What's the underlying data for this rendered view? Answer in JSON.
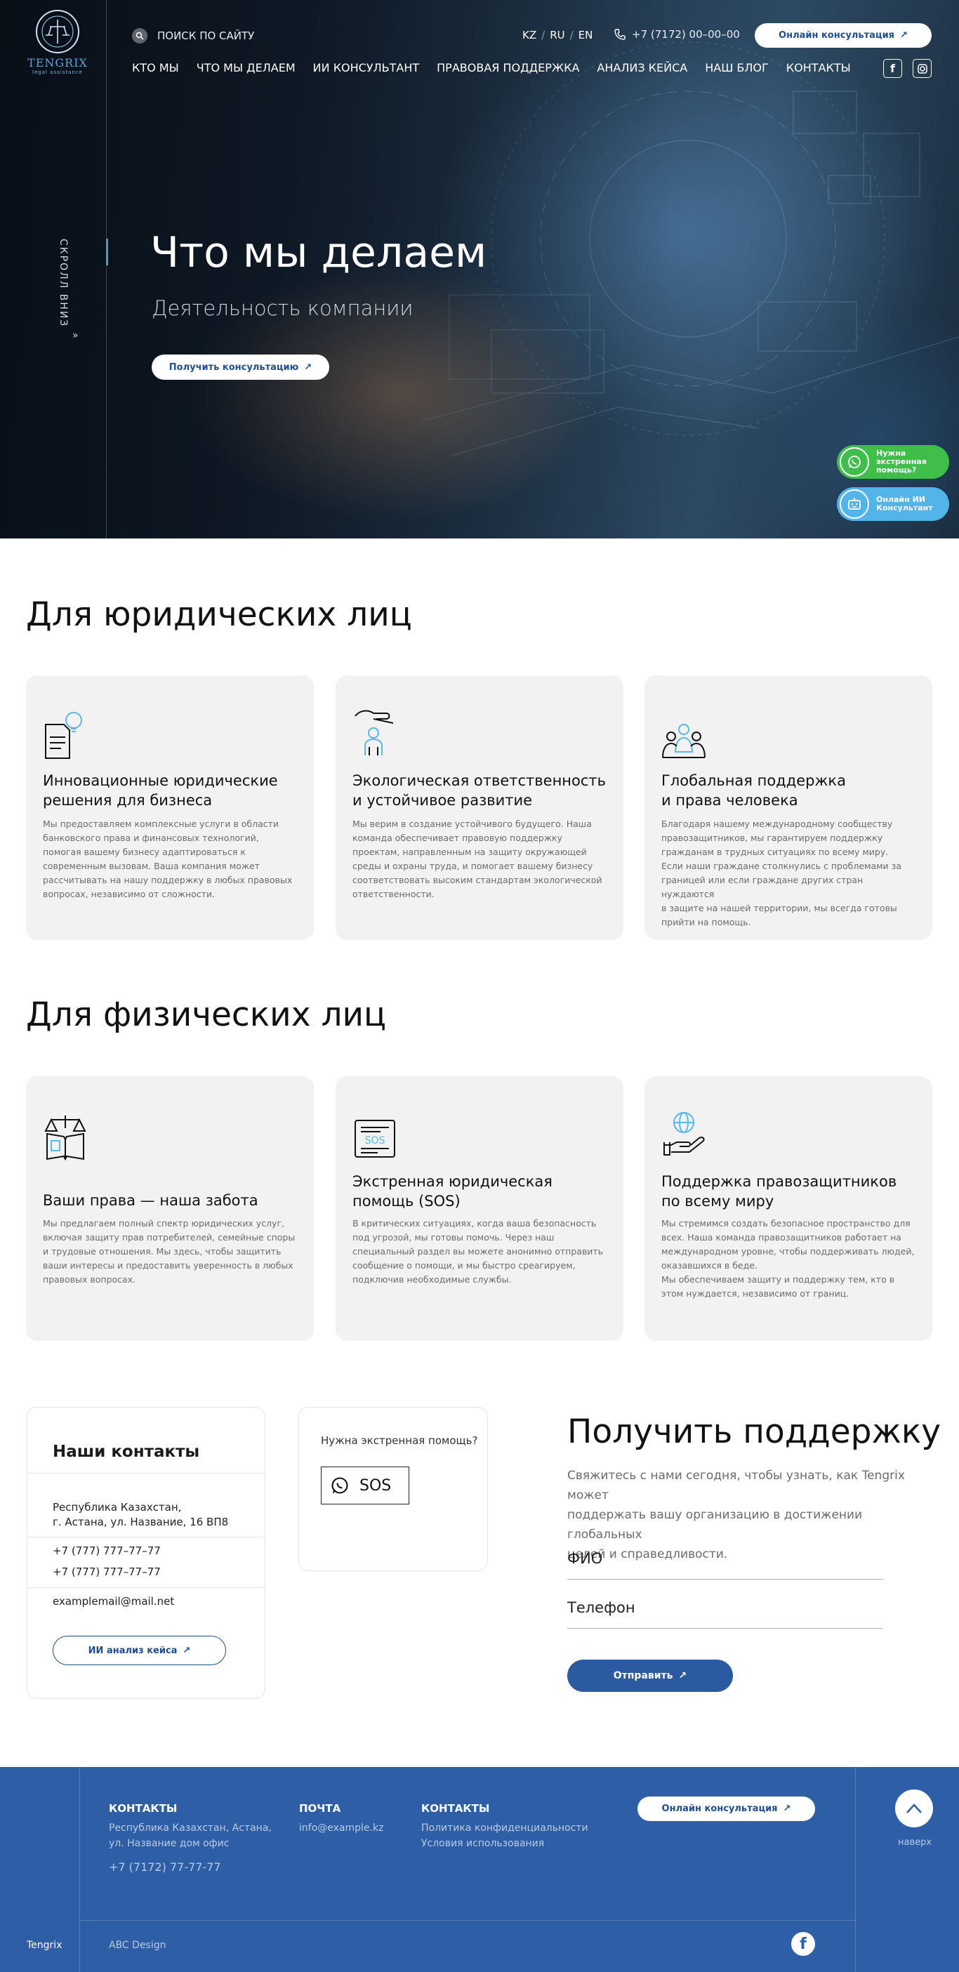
{
  "brand": {
    "name": "TENGRIX",
    "tagline": "legal assistance"
  },
  "header": {
    "search_placeholder": "ПОИСК ПО САЙТУ",
    "languages": [
      "KZ",
      "RU",
      "EN"
    ],
    "phone": "+7 (7172) 00–00–00",
    "cta_label": "Онлайн консультация",
    "nav": [
      "КТО МЫ",
      "ЧТО МЫ ДЕЛАЕМ",
      "ИИ КОНСУЛЬТАНТ",
      "ПРАВОВАЯ ПОДДЕРЖКА",
      "АНАЛИЗ КЕЙСА",
      "НАШ БЛОГ",
      "КОНТАКТЫ"
    ],
    "social": [
      "facebook-icon",
      "instagram-icon"
    ]
  },
  "hero": {
    "scroll_label": "СКРОЛЛ ВНИЗ",
    "title": "Что мы делаем",
    "subtitle": "Деятельность компании",
    "button_label": "Получить консультацию"
  },
  "floating": {
    "emergency": [
      "Нужна",
      "экстренная",
      "помощь?"
    ],
    "ai": [
      "Онлайн ИИ",
      "Консультант"
    ]
  },
  "legal_section": {
    "title": "Для юридических лиц",
    "cards": [
      {
        "icon": "document-idea-icon",
        "title_lines": [
          "Инновационные юридические",
          "решения для бизнеса"
        ],
        "text_lines": [
          "Мы предоставляем комплексные услуги в области",
          "банковского права и финансовых технологий,",
          "помогая вашему бизнесу адаптироваться к",
          "современным вызовам. Ваша компания может",
          "рассчитывать на нашу поддержку в любых правовых",
          "вопросах, независимо от сложности."
        ]
      },
      {
        "icon": "hand-protect-person-icon",
        "title_lines": [
          "Экологическая ответственность",
          "и устойчивое развитие"
        ],
        "text_lines": [
          "Мы верим в создание устойчивого будущего. Наша",
          "команда обеспечивает правовую поддержку",
          "проектам, направленным на защиту окружающей",
          "среды и охраны труда, и помогает вашему бизнесу",
          "соответствовать высоким стандартам экологической",
          "ответственности."
        ]
      },
      {
        "icon": "people-group-icon",
        "title_lines": [
          "Глобальная поддержка",
          "и права человека"
        ],
        "text_lines": [
          "Благодаря нашему международному сообществу",
          "правозащитников, мы гарантируем поддержку",
          "гражданам в трудных ситуациях по всему миру.",
          "Если наши граждане столкнулись с проблемами за",
          "границей или если граждане других стран нуждаются",
          "в защите на нашей территории, мы всегда готовы",
          "прийти на помощь."
        ]
      }
    ]
  },
  "individual_section": {
    "title": "Для физических лиц",
    "cards": [
      {
        "icon": "law-book-scales-icon",
        "title_lines": [
          "Ваши права — наша забота"
        ],
        "text_lines": [
          "Мы предлагаем полный спектр юридических услуг,",
          "включая защиту прав потребителей, семейные споры",
          "и трудовые отношения. Мы здесь, чтобы защитить",
          "ваши интересы и предоставить уверенность в любых",
          "правовых вопросах."
        ]
      },
      {
        "icon": "sos-message-icon",
        "title_lines": [
          "Экстренная юридическая",
          "помощь (SOS)"
        ],
        "text_lines": [
          "В критических ситуациях, когда ваша безопасность",
          "под угрозой, мы готовы помочь. Через наш",
          "специальный раздел вы можете анонимно отправить",
          "сообщение о помощи, и мы быстро среагируем,",
          "подключив необходимые службы."
        ]
      },
      {
        "icon": "globe-hand-icon",
        "title_lines": [
          "Поддержка правозащитников",
          "по всему миру"
        ],
        "text_lines": [
          "Мы стремимся создать безопасное пространство для",
          "всех. Наша команда правозащитников работает на",
          "международном уровне, чтобы поддерживать людей,",
          "оказавшихся в беде.",
          "Мы обеспечиваем защиту и поддержку тем, кто в",
          "этом нуждается, независимо от границ."
        ]
      }
    ]
  },
  "contacts": {
    "title": "Наши контакты",
    "address_lines": [
      "Республика Казахстан,",
      "г. Астана, ул. Название, 16 ВП8"
    ],
    "phones": [
      "+7 (777) 777–77–77",
      "+7 (777) 777–77–77"
    ],
    "email": "examplemail@mail.net",
    "ai_button": "ИИ анализ кейса"
  },
  "sos": {
    "question": "Нужна экстренная помощь?",
    "button": "SOS"
  },
  "support": {
    "title": "Получить поддержку",
    "text_lines": [
      "Свяжитесь с нами сегодня, чтобы узнать, как Tengrix может",
      "поддержать вашу организацию в достижении глобальных",
      "целей и справедливости."
    ],
    "name_placeholder": "ФИО",
    "phone_placeholder": "Телефон",
    "submit": "Отправить"
  },
  "footer": {
    "col1": {
      "heading": "КОНТАКТЫ",
      "lines": [
        "Республика Казахстан, Астана,",
        "ул. Название дом офис"
      ],
      "phone": "+7 (7172) 77-77-77"
    },
    "col2": {
      "heading": "ПОЧТА",
      "email": "info@example.kz"
    },
    "col3": {
      "heading": "КОНТАКТЫ",
      "links": [
        "Политика конфиденциальности",
        "Условия использования"
      ]
    },
    "cta": "Онлайн консультация",
    "up_label": "наверх",
    "brand": "Tengrix",
    "design": "ABC Design"
  },
  "colors": {
    "accent": "#2b5aa0",
    "footer": "#2d5ea6",
    "icon_blue": "#5ab8e8",
    "whatsapp_green": "#3fbf4a",
    "ai_blue": "#52b4e8"
  }
}
